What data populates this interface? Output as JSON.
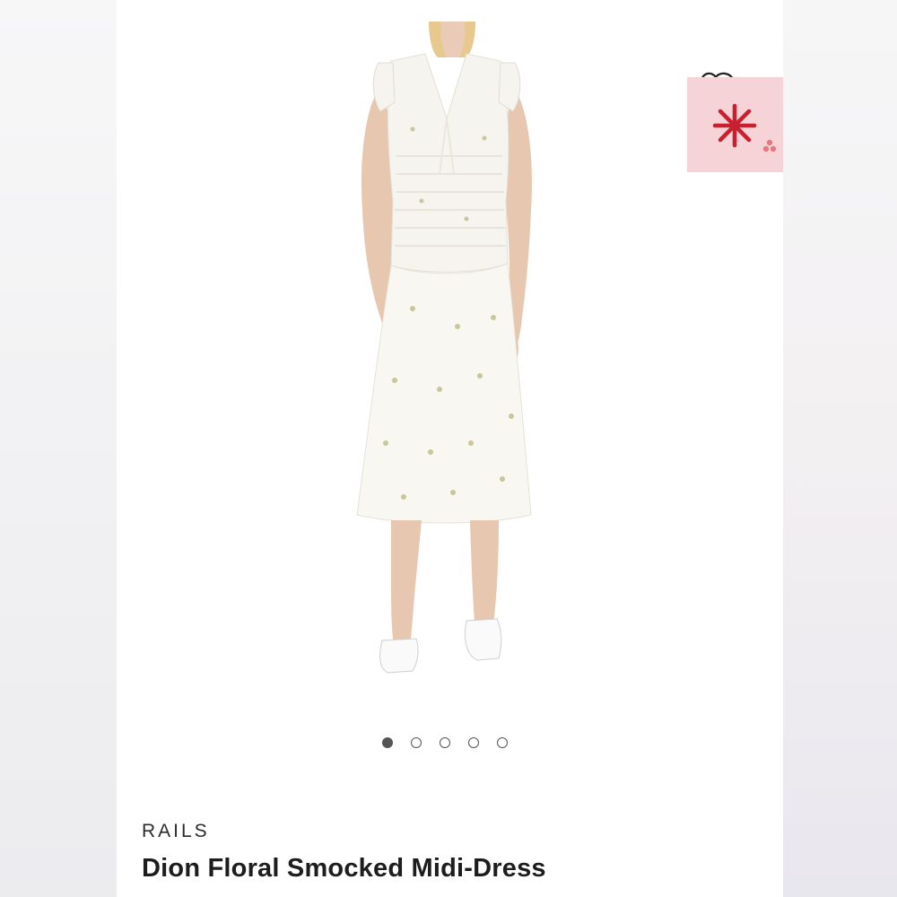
{
  "product": {
    "brand": "RAILS",
    "title": "Dion Floral Smocked Midi-Dress"
  },
  "carousel": {
    "count": 5,
    "active_index": 0
  },
  "icons": {
    "badge": "asterisk-icon",
    "badge_dots": "dots-icon"
  },
  "colors": {
    "badge_bg": "#f6d3d6",
    "badge_icon": "#c8202f",
    "dot_active": "#555555"
  }
}
